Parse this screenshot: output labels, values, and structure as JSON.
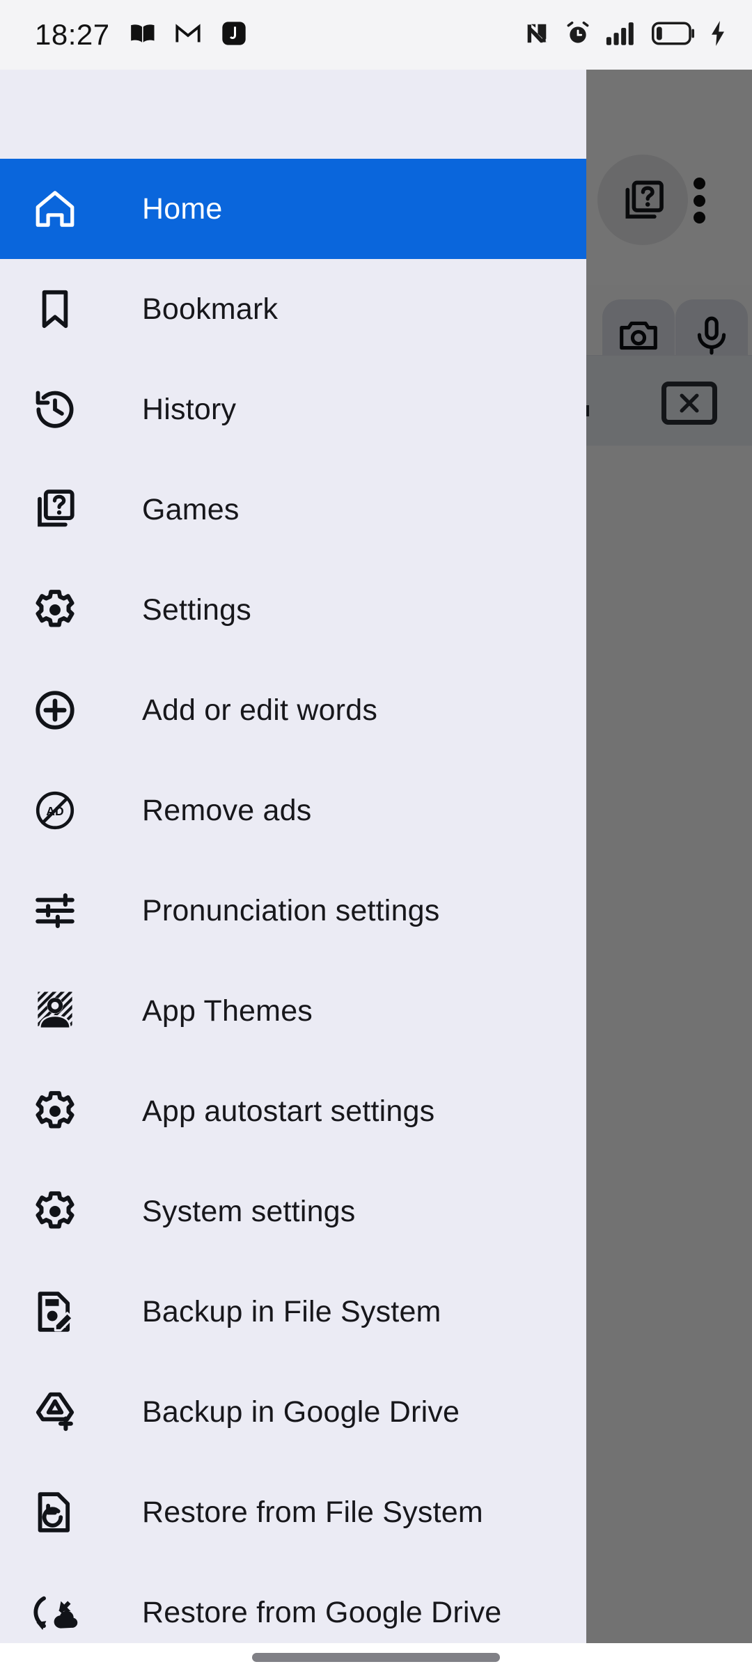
{
  "status_bar": {
    "time": "18:27",
    "left_icons": [
      "book-icon",
      "gmail-icon",
      "app-badge-icon"
    ],
    "right_icons": [
      "nfc-icon",
      "alarm-icon",
      "signal-bars-icon",
      "battery-low-icon",
      "charging-bolt-icon"
    ],
    "battery_level_percent": 15,
    "signal_bars": 4
  },
  "background_app": {
    "toolbar_icons": [
      "games-help-icon",
      "overflow-menu-icon"
    ],
    "action_buttons": [
      "camera-icon",
      "microphone-icon"
    ],
    "clear_button": "close-icon"
  },
  "drawer": {
    "accent_color": "#0a66dc",
    "background_color": "#ebebf4",
    "text_color": "#17171b",
    "active_index": 0,
    "items": [
      {
        "label": "Home",
        "icon": "home-icon"
      },
      {
        "label": "Bookmark",
        "icon": "bookmark-icon"
      },
      {
        "label": "History",
        "icon": "history-icon"
      },
      {
        "label": "Games",
        "icon": "games-help-icon"
      },
      {
        "label": "Settings",
        "icon": "gear-icon"
      },
      {
        "label": "Add or edit words",
        "icon": "plus-circle-icon"
      },
      {
        "label": "Remove ads",
        "icon": "no-ads-icon"
      },
      {
        "label": "Pronunciation settings",
        "icon": "tune-sliders-icon"
      },
      {
        "label": "App Themes",
        "icon": "person-theme-icon"
      },
      {
        "label": "App autostart settings",
        "icon": "gear-icon"
      },
      {
        "label": "System settings",
        "icon": "gear-icon"
      },
      {
        "label": "Backup in File System",
        "icon": "file-edit-icon"
      },
      {
        "label": "Backup in Google Drive",
        "icon": "drive-add-icon"
      },
      {
        "label": "Restore from File System",
        "icon": "file-restore-icon"
      },
      {
        "label": "Restore from Google Drive",
        "icon": "cloud-restore-icon"
      }
    ]
  },
  "navigation_bar": {
    "gesture_pill": "home-gesture-pill"
  }
}
